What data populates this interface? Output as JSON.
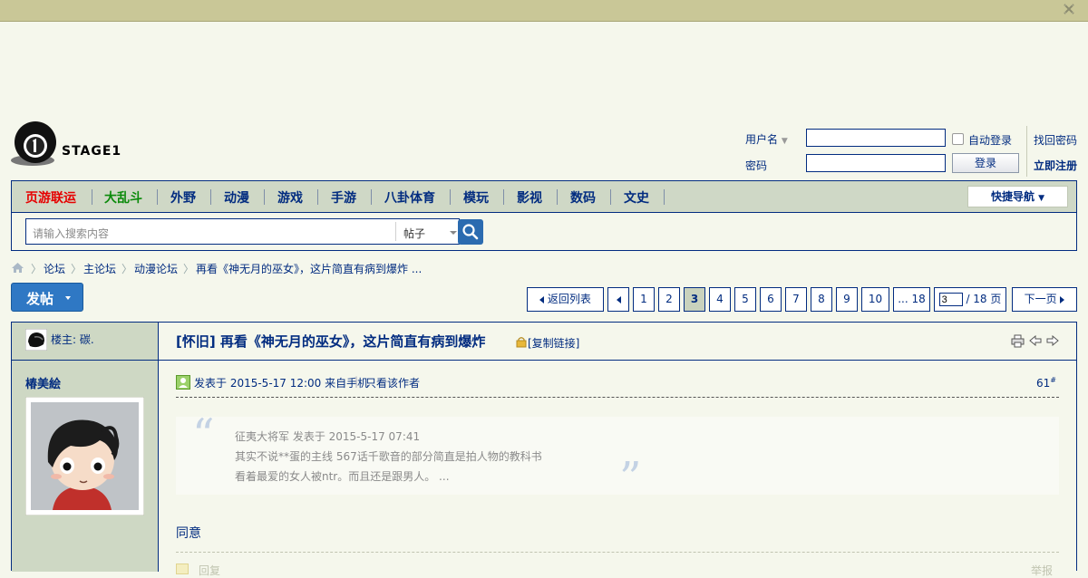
{
  "header": {
    "logo_text": "STAGE1"
  },
  "login": {
    "username_label": "用户名",
    "password_label": "密码",
    "auto_login_label": "自动登录",
    "login_button": "登录",
    "find_password": "找回密码",
    "register": "立即注册"
  },
  "nav": {
    "items": [
      "页游联运",
      "大乱斗",
      "外野",
      "动漫",
      "游戏",
      "手游",
      "八卦体育",
      "模玩",
      "影视",
      "数码",
      "文史"
    ],
    "quick_nav": "快捷导航"
  },
  "search": {
    "placeholder": "请输入搜索内容",
    "type": "帖子"
  },
  "breadcrumb": [
    "论坛",
    "主论坛",
    "动漫论坛",
    "再看《神无月的巫女》，这片简直有病到爆炸 ..."
  ],
  "actions": {
    "post_button": "发帖"
  },
  "pagination": {
    "back_to_list": "返回列表",
    "pages": [
      "1",
      "2",
      "3",
      "4",
      "5",
      "6",
      "7",
      "8",
      "9",
      "10",
      "... 18"
    ],
    "current": "3",
    "page_input_value": "3",
    "total_label": "/ 18 页",
    "next": "下一页"
  },
  "thread": {
    "op_label": "楼主: 碳.",
    "title": "[怀旧] 再看《神无月的巫女》，这片简直有病到爆炸",
    "copy_link": "[复制链接]"
  },
  "post": {
    "author": "椿美絵",
    "meta": "发表于 2015-5-17 12:00 来自手机",
    "only_author": "只看该作者",
    "floor": "61",
    "floor_mark": "#",
    "quote_header": "征夷大将军 发表于 2015-5-17 07:41",
    "quote_line1": "其实不说**蛋的主线 567话千歌音的部分简直是拍人物的教科书",
    "quote_line2": "看着最爱的女人被ntr。而且还是跟男人。 ...",
    "body": "同意",
    "reply_label": "回复",
    "report_label": "举报"
  },
  "colors": {
    "accent": "#022c80",
    "hot": "#e60000",
    "green": "#0a8a0a",
    "topbar": "#c9c797",
    "primary_button": "#2f78c4"
  }
}
